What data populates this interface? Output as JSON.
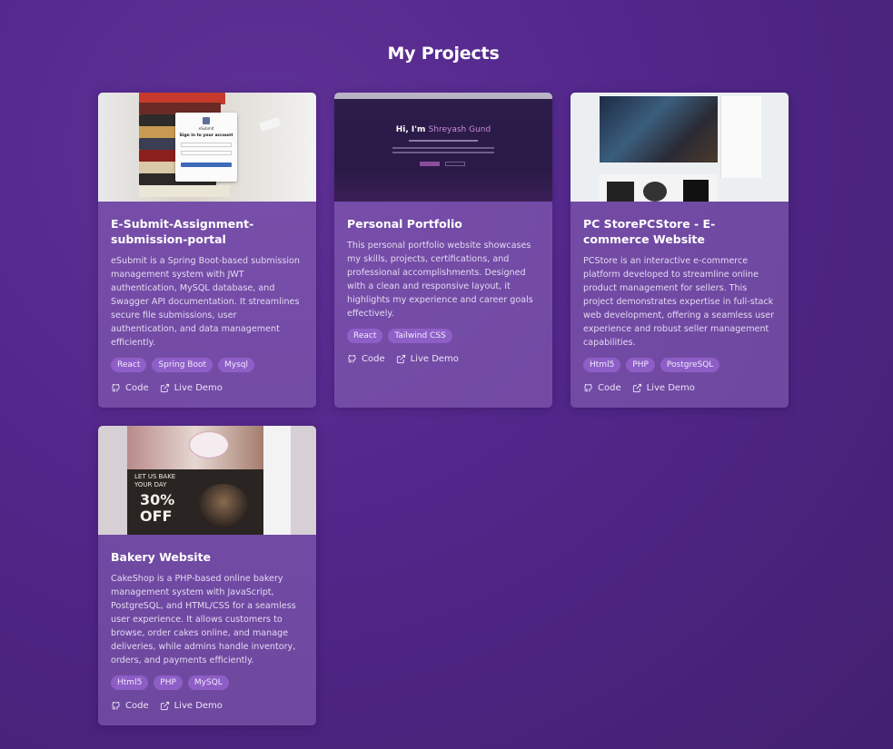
{
  "section": {
    "title": "My Projects"
  },
  "projects": [
    {
      "title": "E-Submit-Assignment-submission-portal",
      "description": "eSubmit is a Spring Boot-based submission management system with JWT authentication, MySQL database, and Swagger API documentation. It streamlines secure file submissions, user authentication, and data management efficiently.",
      "tags": [
        "React",
        "Spring Boot",
        "Mysql"
      ],
      "code_label": "Code",
      "demo_label": "Live Demo"
    },
    {
      "title": "Personal Portfolio",
      "description": "This personal portfolio website showcases my skills, projects, certifications, and professional accomplishments. Designed with a clean and responsive layout, it highlights my experience and career goals effectively.",
      "tags": [
        "React",
        "Tailwind CSS"
      ],
      "code_label": "Code",
      "demo_label": "Live Demo"
    },
    {
      "title": "PC StorePCStore - E-commerce Website",
      "description": "PCStore is an interactive e-commerce platform developed to streamline online product management for sellers. This project demonstrates expertise in full-stack web development, offering a seamless user experience and robust seller management capabilities.",
      "tags": [
        "Html5",
        "PHP",
        "PostgreSQL"
      ],
      "code_label": "Code",
      "demo_label": "Live Demo"
    },
    {
      "title": "Bakery Website",
      "description": "CakeShop is a PHP-based online bakery management system with JavaScript, PostgreSQL, and HTML/CSS for a seamless user experience. It allows customers to browse, order cakes online, and manage deliveries, while admins handle inventory, orders, and payments efficiently.",
      "tags": [
        "Html5",
        "PHP",
        "MySQL"
      ],
      "code_label": "Code",
      "demo_label": "Live Demo"
    }
  ],
  "thumbnails": {
    "esubmit": {
      "signin_brand": "eSubmit",
      "signin_heading": "Sign in to your account"
    },
    "portfolio": {
      "hero_prefix": "Hi, I'm ",
      "hero_name": "Shreyash Gund"
    },
    "bakery": {
      "promo_line1": "LET US BAKE",
      "promo_line2": "YOUR DAY",
      "promo_discount": "30%",
      "promo_off": "OFF"
    }
  }
}
